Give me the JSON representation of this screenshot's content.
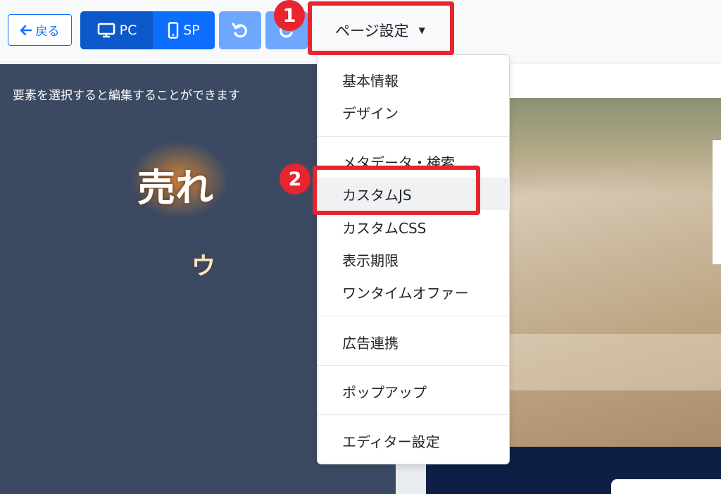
{
  "toolbar": {
    "back_label": "戻る",
    "pc_label": "PC",
    "sp_label": "SP",
    "page_settings_label": "ページ設定"
  },
  "left_panel": {
    "hint": "要素を選択すると編集することができます"
  },
  "preview": {
    "hero_title": "売れ",
    "hero_sub": "ウ"
  },
  "dropdown": {
    "items": [
      {
        "label": "基本情報"
      },
      {
        "label": "デザイン"
      },
      {
        "label": "メタデータ・検索"
      },
      {
        "label": "カスタムJS"
      },
      {
        "label": "カスタムCSS"
      },
      {
        "label": "表示期限"
      },
      {
        "label": "ワンタイムオファー"
      },
      {
        "label": "広告連携"
      },
      {
        "label": "ポップアップ"
      },
      {
        "label": "エディター設定"
      }
    ]
  },
  "callouts": {
    "first": "1",
    "second": "2"
  },
  "colors": {
    "primary": "#0d6efd",
    "primary_dark": "#0a58ca",
    "light_primary": "#6ea8fe",
    "panel": "#3b4a62",
    "highlight": "#e8242f"
  }
}
